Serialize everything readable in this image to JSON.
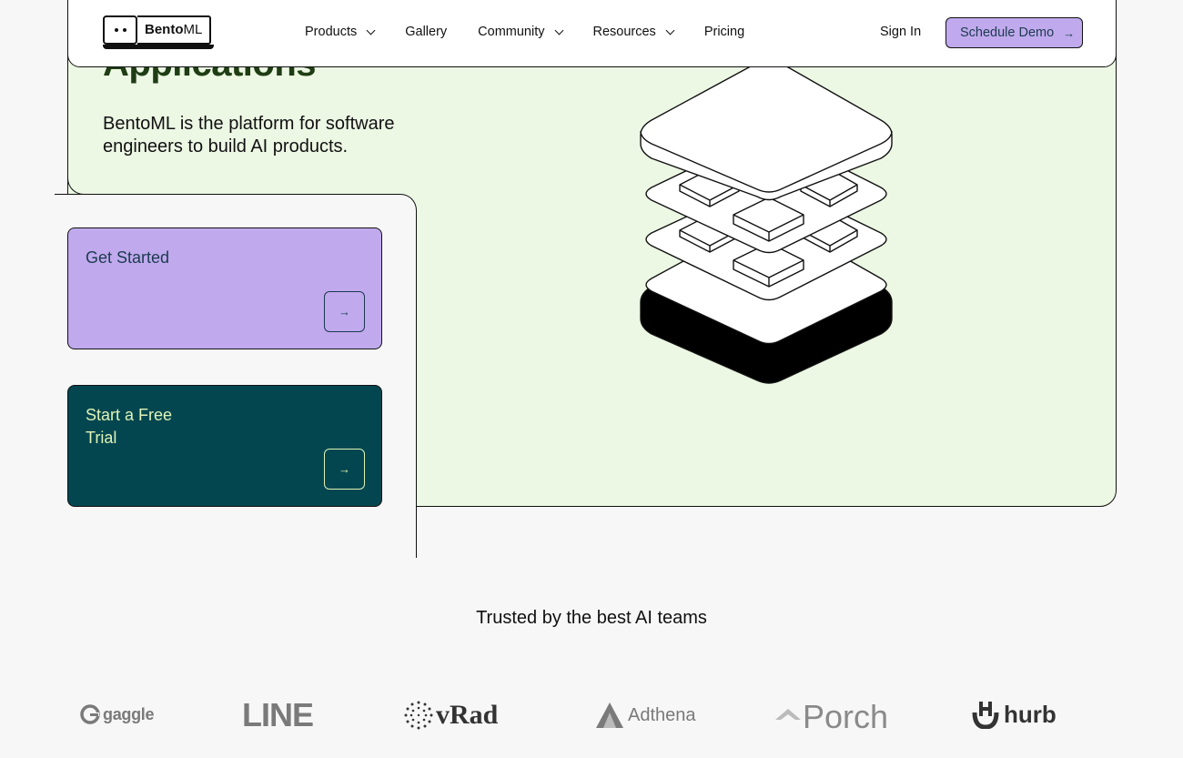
{
  "header": {
    "brand_name_bold": "Bento",
    "brand_name_light": "ML",
    "nav": [
      {
        "label": "Products",
        "dropdown": true
      },
      {
        "label": "Gallery",
        "dropdown": false
      },
      {
        "label": "Community",
        "dropdown": true
      },
      {
        "label": "Resources",
        "dropdown": true
      },
      {
        "label": "Pricing",
        "dropdown": false
      }
    ],
    "sign_in": "Sign In",
    "demo_button": "Schedule Demo",
    "demo_arrow": "→"
  },
  "hero": {
    "title": "Applications",
    "description": "BentoML is the platform for software engineers to build AI products."
  },
  "cards": {
    "get_started": {
      "label": "Get Started",
      "arrow": "→"
    },
    "free_trial": {
      "label": "Start a Free Trial",
      "arrow": "→"
    }
  },
  "trusted": {
    "heading": "Trusted by the best AI teams",
    "logos": [
      {
        "name": "gaggle",
        "icon": "gaggle-logo-icon"
      },
      {
        "name": "LINE",
        "icon": "line-logo-icon"
      },
      {
        "name": "vRad",
        "icon": "vrad-logo-icon"
      },
      {
        "name": "Adthena",
        "icon": "adthena-logo-icon"
      },
      {
        "name": "Porch",
        "icon": "porch-logo-icon"
      },
      {
        "name": "hurb",
        "icon": "hurb-logo-icon"
      }
    ]
  },
  "colors": {
    "accent_purple": "#c0aaed",
    "teal": "#044650",
    "hero_green": "#ecf7e4",
    "lime_text": "#dff3b5"
  }
}
